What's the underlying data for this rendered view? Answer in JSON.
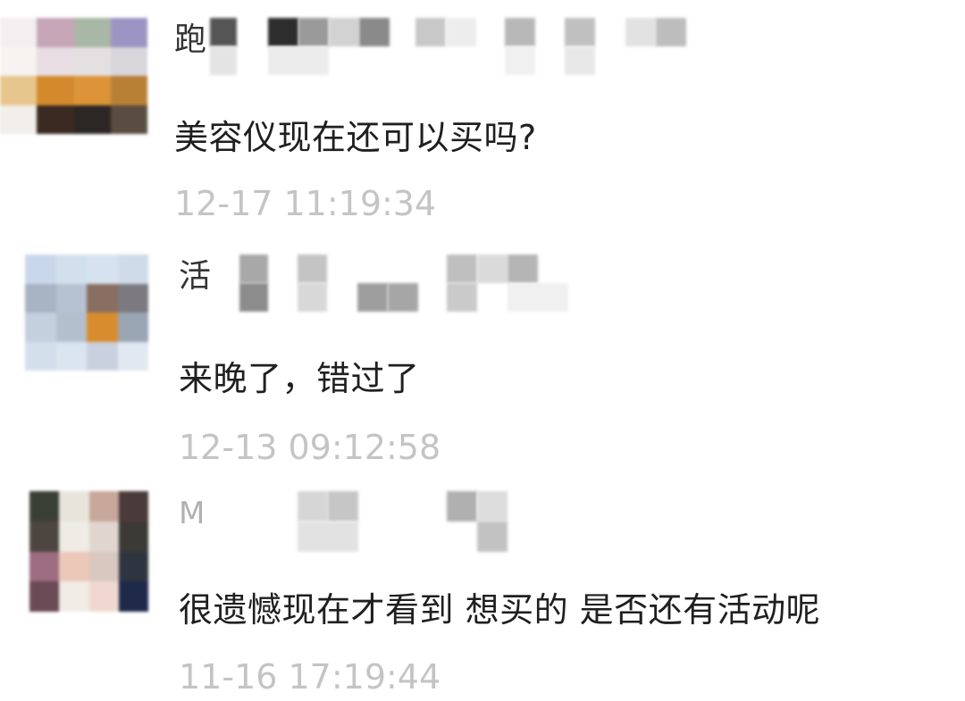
{
  "comments": [
    {
      "name_visible": "跑",
      "text": "美容仪现在还可以买吗?",
      "time": "12-17 11:19:34"
    },
    {
      "name_visible": "活",
      "text": "来晚了，错过了",
      "time": "12-13 09:12:58"
    },
    {
      "name_visible": "M",
      "text": "很遗憾现在才看到  想买的  是否还有活动呢",
      "time": "11-16 17:19:44"
    }
  ]
}
